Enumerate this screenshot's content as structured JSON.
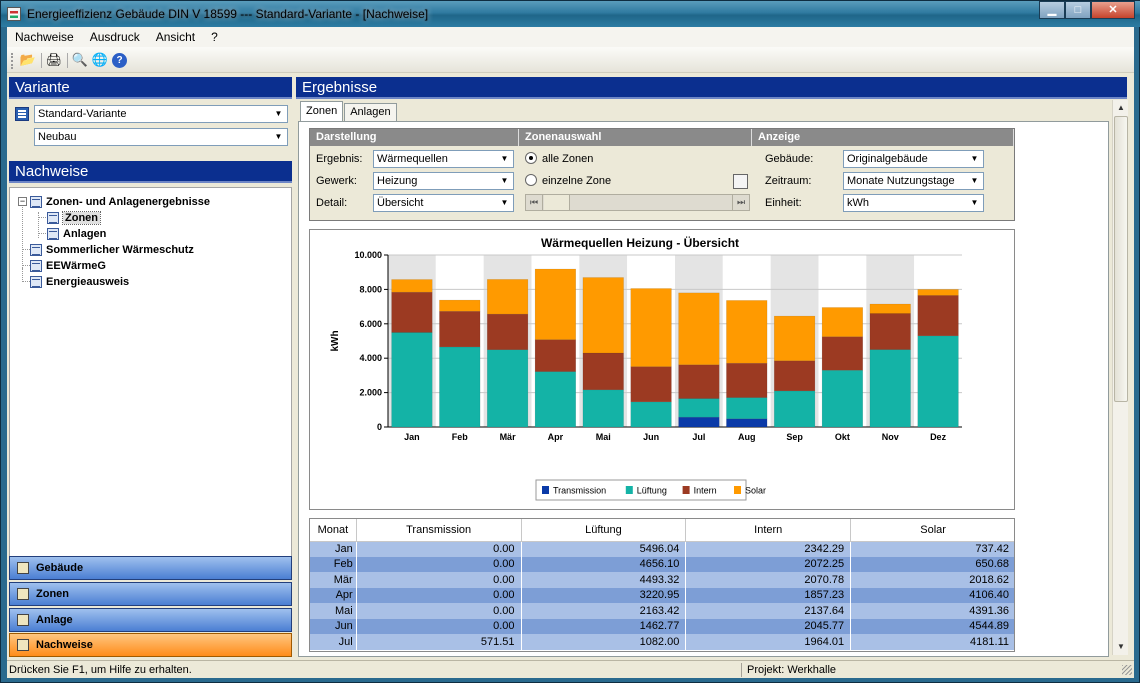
{
  "window": {
    "title": "Energieeffizienz Gebäude DIN V 18599 --- Standard-Variante - [Nachweise]",
    "controls": {
      "minimize": "▁",
      "maximize": "□",
      "close": "✕"
    }
  },
  "menu": [
    {
      "label": "Nachweise"
    },
    {
      "label": "Ausdruck"
    },
    {
      "label": "Ansicht"
    },
    {
      "label": "?"
    }
  ],
  "toolbar": {
    "open_icon": "📂",
    "print_icon": "🖨",
    "preview_icon": "🔍",
    "web_icon": "🌐",
    "help_icon": "?"
  },
  "left": {
    "variante_header": "Variante",
    "variante_select": "Standard-Variante",
    "bauart_select": "Neubau",
    "nachweise_header": "Nachweise",
    "tree": {
      "root": "Zonen- und Anlagenergebnisse",
      "child_zonen": "Zonen",
      "child_anlagen": "Anlagen",
      "sommer": "Sommerlicher Wärmeschutz",
      "eewaerme": "EEWärmeG",
      "ausweis": "Energieausweis"
    },
    "nav": {
      "gebaeude": "Gebäude",
      "zonen": "Zonen",
      "anlage": "Anlage",
      "nachweise": "Nachweise"
    }
  },
  "right": {
    "header": "Ergebnisse",
    "tabs": [
      {
        "label": "Zonen"
      },
      {
        "label": "Anlagen"
      }
    ],
    "options": {
      "darstellung_header": "Darstellung",
      "zonenauswahl_header": "Zonenauswahl",
      "anzeige_header": "Anzeige",
      "ergebnis_label": "Ergebnis:",
      "ergebnis_value": "Wärmequellen",
      "gewerk_label": "Gewerk:",
      "gewerk_value": "Heizung",
      "detail_label": "Detail:",
      "detail_value": "Übersicht",
      "alle_zonen": "alle Zonen",
      "einzelne_zone": "einzelne Zone",
      "gebaeude_label": "Gebäude:",
      "gebaeude_value": "Originalgebäude",
      "zeitraum_label": "Zeitraum:",
      "zeitraum_value": "Monate Nutzungstage",
      "einheit_label": "Einheit:",
      "einheit_value": "kWh"
    }
  },
  "chart_data": {
    "type": "bar",
    "stacked": true,
    "title": "Wärmequellen Heizung - Übersicht",
    "ylabel": "kWh",
    "xlabel": "",
    "ylim": [
      0,
      10000
    ],
    "yticks": [
      "0",
      "2.000",
      "4.000",
      "6.000",
      "8.000",
      "10.000"
    ],
    "categories": [
      "Jan",
      "Feb",
      "Mär",
      "Apr",
      "Mai",
      "Jun",
      "Jul",
      "Aug",
      "Sep",
      "Okt",
      "Nov",
      "Dez"
    ],
    "series": [
      {
        "name": "Transmission",
        "color": "#0a3aa8",
        "values": [
          0,
          0,
          0,
          0,
          0,
          0,
          571.51,
          480,
          0,
          0,
          0,
          0
        ]
      },
      {
        "name": "Lüftung",
        "color": "#14b3a6",
        "values": [
          5496.04,
          4656.1,
          4493.32,
          3220.95,
          2163.42,
          1462.77,
          1082.0,
          1230,
          2100,
          3300,
          4500,
          5300
        ]
      },
      {
        "name": "Intern",
        "color": "#9c3a22",
        "values": [
          2342.29,
          2072.25,
          2070.78,
          1857.23,
          2137.64,
          2045.77,
          1964.01,
          2000,
          1750,
          1950,
          2100,
          2350
        ]
      },
      {
        "name": "Solar",
        "color": "#ff9a00",
        "values": [
          737.42,
          650.68,
          2018.62,
          4106.4,
          4391.36,
          4544.89,
          4181.11,
          3650,
          2600,
          1700,
          550,
          350
        ]
      }
    ],
    "legend": "bottom",
    "grid": true
  },
  "table": {
    "headers": [
      "Monat",
      "Transmission",
      "Lüftung",
      "Intern",
      "Solar"
    ],
    "rows": [
      [
        "Jan",
        "0.00",
        "5496.04",
        "2342.29",
        "737.42"
      ],
      [
        "Feb",
        "0.00",
        "4656.10",
        "2072.25",
        "650.68"
      ],
      [
        "Mär",
        "0.00",
        "4493.32",
        "2070.78",
        "2018.62"
      ],
      [
        "Apr",
        "0.00",
        "3220.95",
        "1857.23",
        "4106.40"
      ],
      [
        "Mai",
        "0.00",
        "2163.42",
        "2137.64",
        "4391.36"
      ],
      [
        "Jun",
        "0.00",
        "1462.77",
        "2045.77",
        "4544.89"
      ],
      [
        "Jul",
        "571.51",
        "1082.00",
        "1964.01",
        "4181.11"
      ]
    ]
  },
  "status": {
    "left": "Drücken Sie F1, um Hilfe zu erhalten.",
    "right": "Projekt: Werkhalle"
  }
}
